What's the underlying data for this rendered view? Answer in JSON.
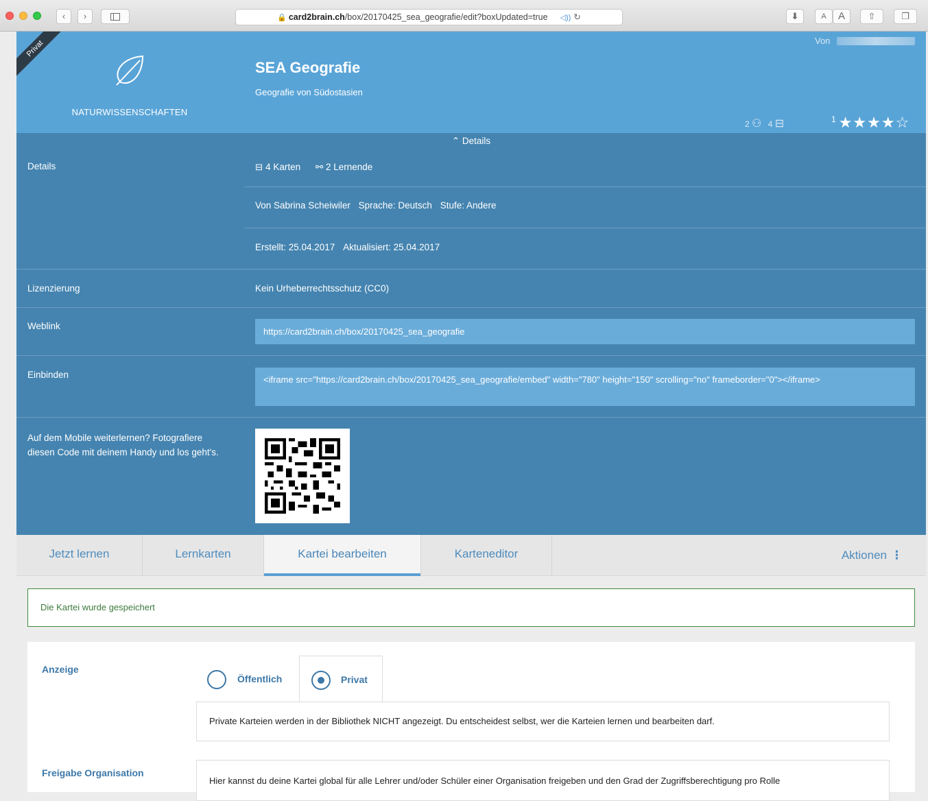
{
  "browser": {
    "url_domain": "card2brain.ch",
    "url_path": "/box/20170425_sea_geografie/edit?boxUpdated=true",
    "reader_small": "A",
    "reader_large": "A"
  },
  "header": {
    "ribbon": "Privat",
    "category": "NATURWISSENSCHAFTEN",
    "title": "SEA Geografie",
    "subtitle": "Geografie von Südostasien",
    "von_label": "Von",
    "learners_count": "2",
    "cards_count": "4",
    "rating_count": "1",
    "stars": "★★★★☆"
  },
  "details": {
    "toggle_label": "Details",
    "details_label": "Details",
    "cards": "4 Karten",
    "learners": "2 Lernende",
    "author": "Von Sabrina Scheiwiler",
    "language": "Sprache: Deutsch",
    "level": "Stufe: Andere",
    "created": "Erstellt: 25.04.2017",
    "updated": "Aktualisiert: 25.04.2017",
    "license_label": "Lizenzierung",
    "license_value": "Kein Urheberrechtsschutz (CC0)",
    "weblink_label": "Weblink",
    "weblink_value": "https://card2brain.ch/box/20170425_sea_geografie",
    "embed_label": "Einbinden",
    "embed_value": "<iframe src=\"https://card2brain.ch/box/20170425_sea_geografie/embed\" width=\"780\" height=\"150\" scrolling=\"no\" frameborder=\"0\"></iframe>",
    "mobile_text": "Auf dem Mobile weiterlernen? Fotografiere diesen Code mit deinem Handy und los geht's."
  },
  "tabs": {
    "learn": "Jetzt lernen",
    "cards": "Lernkarten",
    "edit_box": "Kartei bearbeiten",
    "card_editor": "Karteneditor",
    "actions": "Aktionen"
  },
  "alert": {
    "message": "Die Kartei wurde gespeichert"
  },
  "form": {
    "display_label": "Anzeige",
    "public_option": "Öffentlich",
    "private_option": "Privat",
    "selected": "Privat",
    "private_info": "Private Karteien werden in der Bibliothek NICHT angezeigt. Du entscheidest selbst, wer die Karteien lernen und bearbeiten darf.",
    "org_label": "Freigabe Organisation",
    "org_info": "Hier kannst du deine Kartei global für alle Lehrer und/oder Schüler einer Organisation freigeben und den Grad der Zugriffsberechtigung pro Rolle"
  },
  "colors": {
    "header_bg": "#59a4d7",
    "details_bg": "#4584b0",
    "accent": "#3d78a8",
    "success": "#3c8a3c"
  }
}
